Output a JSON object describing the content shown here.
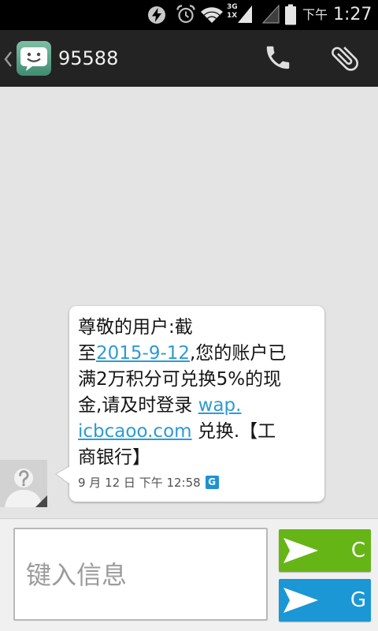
{
  "status_bar": {
    "network_type_top": "3G",
    "network_type_bottom": "1X",
    "period": "下午",
    "time": "1:27",
    "icons": [
      "power-saver-icon",
      "alarm-icon",
      "wifi-icon",
      "signal-icon",
      "no-signal-icon",
      "battery-icon"
    ]
  },
  "action_bar": {
    "title": "95588",
    "app_icon": "messaging-app-icon",
    "actions": [
      "call-icon",
      "attach-icon"
    ]
  },
  "conversation": {
    "messages": [
      {
        "avatar": "unknown-contact-icon",
        "body": [
          {
            "text": "尊敬的用户:截\n至",
            "is_link": false
          },
          {
            "text": "2015-9-12",
            "is_link": true
          },
          {
            "text": ",您的账户已\n满2万积分可兑换5%的现\n金,请及时登录 ",
            "is_link": false
          },
          {
            "text": "wap.\nicbcaoo.com",
            "is_link": true
          },
          {
            "text": " 兑换.【工\n商银行】",
            "is_link": false
          }
        ],
        "timestamp": "9 月 12 日 下午 12:58",
        "sim_badge": "G"
      }
    ]
  },
  "composer": {
    "placeholder": "键入信息",
    "value": "",
    "send_buttons": [
      {
        "label": "C",
        "icon": "send-icon",
        "color": "#66b517"
      },
      {
        "label": "G",
        "icon": "send-icon",
        "color": "#1a97d4"
      }
    ]
  },
  "colors": {
    "status_bar": "#000000",
    "action_bar": "#232323",
    "conversation_bg": "#e4e4e4",
    "bubble": "#ffffff",
    "link": "#2f9ad3",
    "sim_badge": "#1c93d1"
  }
}
